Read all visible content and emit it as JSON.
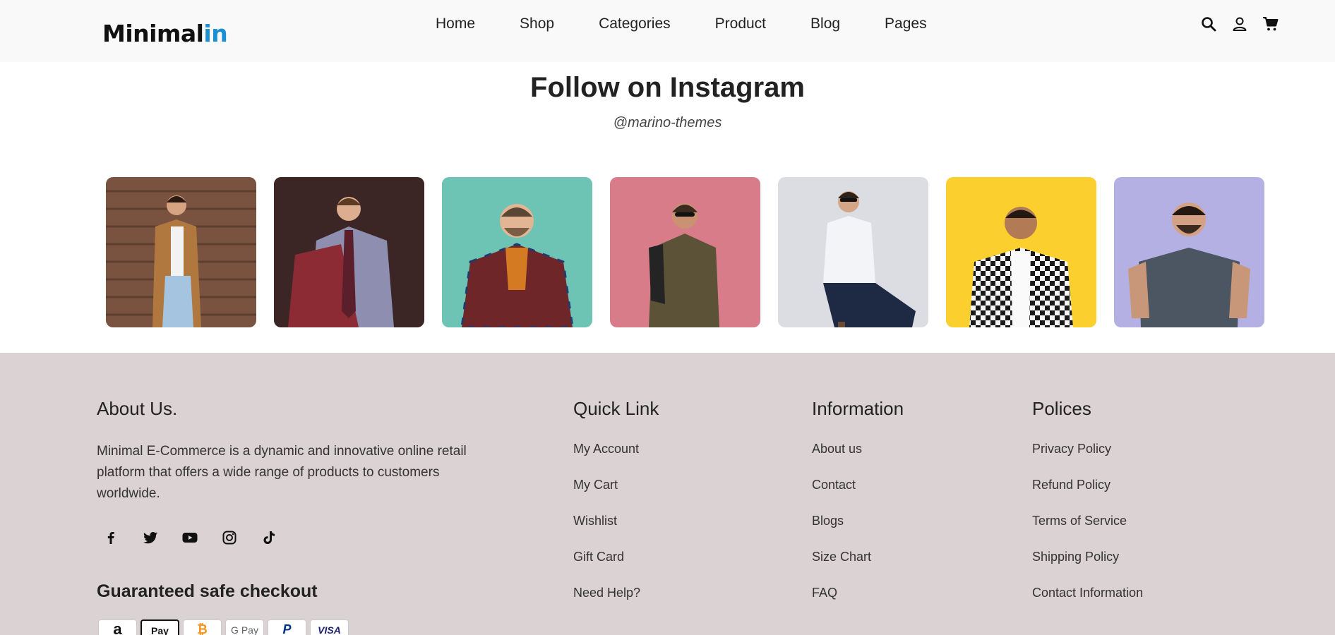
{
  "header": {
    "logo_main": "Minimal",
    "logo_accent": "in",
    "nav": [
      "Home",
      "Shop",
      "Categories",
      "Product",
      "Blog",
      "Pages"
    ],
    "icons": [
      "search-icon",
      "user-icon",
      "cart-icon"
    ]
  },
  "instagram": {
    "title": "Follow on Instagram",
    "handle": "@marino-themes",
    "photos": [
      {
        "bg": "#7a5340",
        "subject": "man in camel coat against wood wall"
      },
      {
        "bg": "#3b2525",
        "subject": "man in suit holding red plaid jacket"
      },
      {
        "bg": "#6dc4b5",
        "subject": "man in plaid blazer on teal"
      },
      {
        "bg": "#d97c8a",
        "subject": "man in olive sweater on pink"
      },
      {
        "bg": "#dcdde2",
        "subject": "man in white shirt seated"
      },
      {
        "bg": "#fbd02e",
        "subject": "man in checked shirt on yellow"
      },
      {
        "bg": "#b4b0e4",
        "subject": "man in grey t-shirt on lavender"
      }
    ]
  },
  "footer": {
    "about": {
      "title": "About Us.",
      "text": "Minimal E-Commerce is a dynamic and innovative online retail platform that offers a wide range of products to customers worldwide."
    },
    "socials": [
      "facebook-icon",
      "twitter-icon",
      "youtube-icon",
      "instagram-icon",
      "tiktok-icon"
    ],
    "checkout_title": "Guaranteed safe checkout",
    "payments": [
      "a",
      "Pay",
      "₿",
      "G Pay",
      "P",
      "VISA"
    ],
    "quick_link": {
      "title": "Quick Link",
      "items": [
        "My Account",
        "My Cart",
        "Wishlist",
        "Gift Card",
        "Need Help?"
      ]
    },
    "information": {
      "title": "Information",
      "items": [
        "About us",
        "Contact",
        "Blogs",
        "Size Chart",
        "FAQ"
      ]
    },
    "policies": {
      "title": "Polices",
      "items": [
        "Privacy Policy",
        "Refund Policy",
        "Terms of Service",
        "Shipping Policy",
        "Contact Information"
      ]
    }
  },
  "colors": {
    "header_bg": "#f9f9f9",
    "footer_bg": "#dbd2d3",
    "logo_accent": "#1a8fd1"
  }
}
